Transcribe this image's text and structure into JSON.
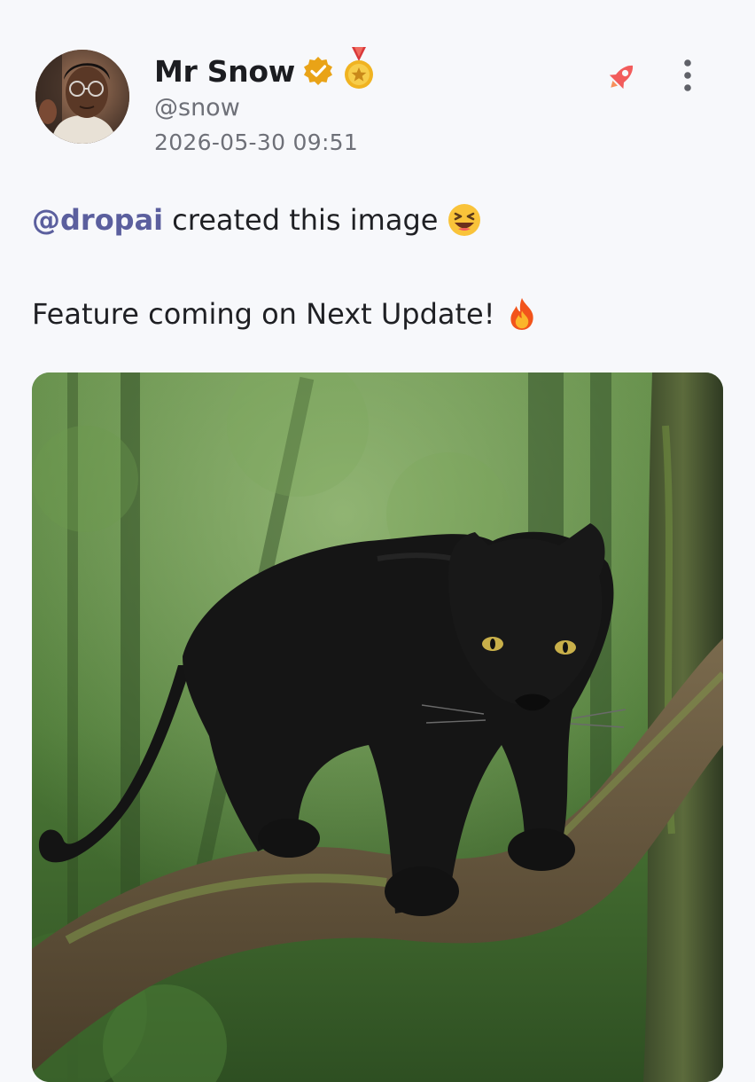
{
  "post": {
    "author": {
      "display_name": "Mr Snow",
      "handle": "@snow",
      "verified": true,
      "badge_icon": "medal-icon"
    },
    "timestamp": "2026-05-30 09:51",
    "actions": {
      "boost_icon": "rocket-icon",
      "more_icon": "more-vertical-icon"
    },
    "content": {
      "mention": "@dropai",
      "line1_text": "created this image",
      "line1_emoji": "laughing-emoji",
      "line2_text": "Feature coming on Next Update!",
      "line2_emoji": "fire-emoji"
    },
    "image": {
      "subject": "black-panther-on-tree-branch"
    },
    "colors": {
      "background": "#f7f8fb",
      "mention": "#5b5f9e",
      "muted_text": "#6e7078",
      "verified": "#e9a317",
      "rocket": "#f25c5c"
    }
  }
}
